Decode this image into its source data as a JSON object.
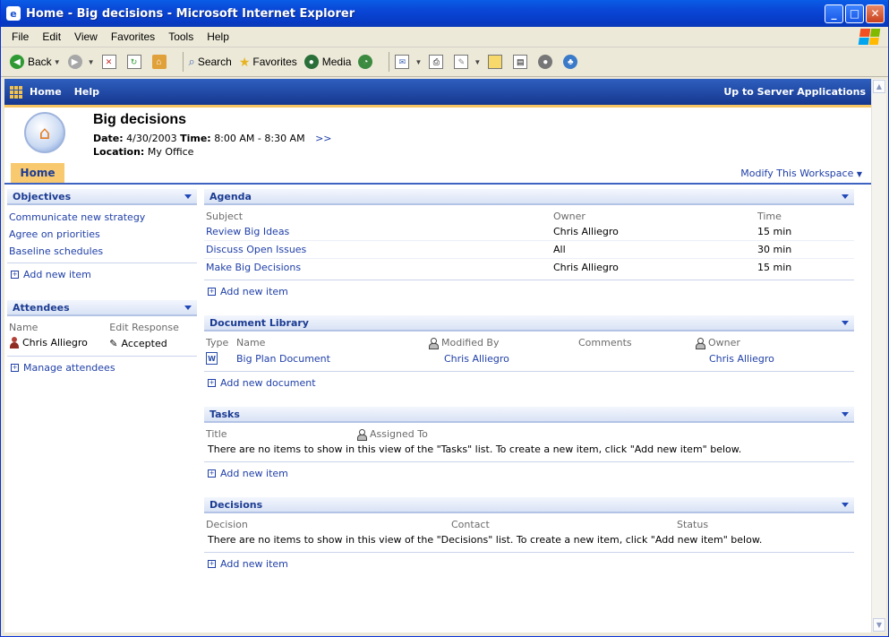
{
  "window": {
    "title": "Home - Big decisions - Microsoft Internet Explorer"
  },
  "menu": [
    "File",
    "Edit",
    "View",
    "Favorites",
    "Tools",
    "Help"
  ],
  "toolbar": {
    "back": "Back",
    "search": "Search",
    "favorites": "Favorites",
    "media": "Media"
  },
  "spnav": {
    "home": "Home",
    "help": "Help",
    "up": "Up to Server Applications"
  },
  "workspace": {
    "title": "Big decisions",
    "date_label": "Date:",
    "date": "4/30/2003",
    "time_label": "Time:",
    "time": "8:00 AM - 8:30 AM",
    "more": ">>",
    "location_label": "Location:",
    "location": "My Office"
  },
  "tabs": {
    "home": "Home",
    "modify": "Modify This Workspace"
  },
  "objectives": {
    "title": "Objectives",
    "items": [
      "Communicate new strategy",
      "Agree on priorities",
      "Baseline schedules"
    ],
    "add": "Add new item"
  },
  "attendees": {
    "title": "Attendees",
    "col_name": "Name",
    "col_response": "Edit Response",
    "rows": [
      {
        "name": "Chris Alliegro",
        "response": "Accepted"
      }
    ],
    "manage": "Manage attendees"
  },
  "agenda": {
    "title": "Agenda",
    "cols": [
      "Subject",
      "Owner",
      "Time"
    ],
    "rows": [
      {
        "subject": "Review Big Ideas",
        "owner": "Chris Alliegro",
        "time": "15 min"
      },
      {
        "subject": "Discuss Open Issues",
        "owner": "All",
        "time": "30 min"
      },
      {
        "subject": "Make Big Decisions",
        "owner": "Chris Alliegro",
        "time": "15 min"
      }
    ],
    "add": "Add new item"
  },
  "doclib": {
    "title": "Document Library",
    "cols": [
      "Type",
      "Name",
      "Modified By",
      "Comments",
      "Owner"
    ],
    "rows": [
      {
        "name": "Big Plan Document",
        "modified_by": "Chris Alliegro",
        "comments": "",
        "owner": "Chris Alliegro"
      }
    ],
    "add": "Add new document"
  },
  "tasks": {
    "title": "Tasks",
    "cols": [
      "Title",
      "Assigned To"
    ],
    "empty": "There are no items to show in this view of the \"Tasks\" list. To create a new item, click \"Add new item\" below.",
    "add": "Add new item"
  },
  "decisions": {
    "title": "Decisions",
    "cols": [
      "Decision",
      "Contact",
      "Status"
    ],
    "empty": "There are no items to show in this view of the \"Decisions\" list. To create a new item, click \"Add new item\" below.",
    "add": "Add new item"
  }
}
